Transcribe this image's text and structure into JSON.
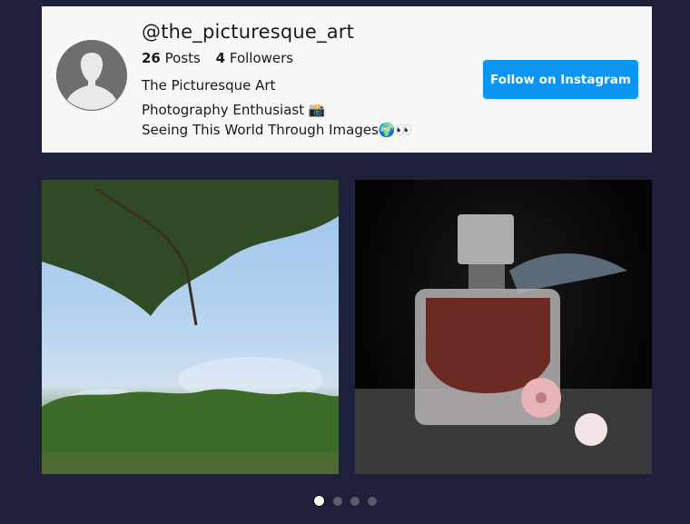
{
  "profile": {
    "handle": "@the_picturesque_art",
    "posts_count": "26",
    "posts_label": "Posts",
    "followers_count": "4",
    "followers_label": "Followers",
    "display_name": "The Picturesque Art",
    "bio_line1": "Photography Enthusiast 📸",
    "bio_line2": "Seeing This World Through Images🌍👀",
    "avatar_icon": "default-user-silhouette-icon"
  },
  "actions": {
    "follow_label": "Follow on Instagram"
  },
  "colors": {
    "background": "#1f203b",
    "card": "#f7f7f7",
    "accent": "#0b95f5"
  },
  "gallery": {
    "images": [
      {
        "alt": "Tree canopy against blue sky with forest below"
      },
      {
        "alt": "Perfume bottle with pink flower decorations on dark background"
      }
    ],
    "pagination": {
      "total": 4,
      "active": 1
    }
  }
}
